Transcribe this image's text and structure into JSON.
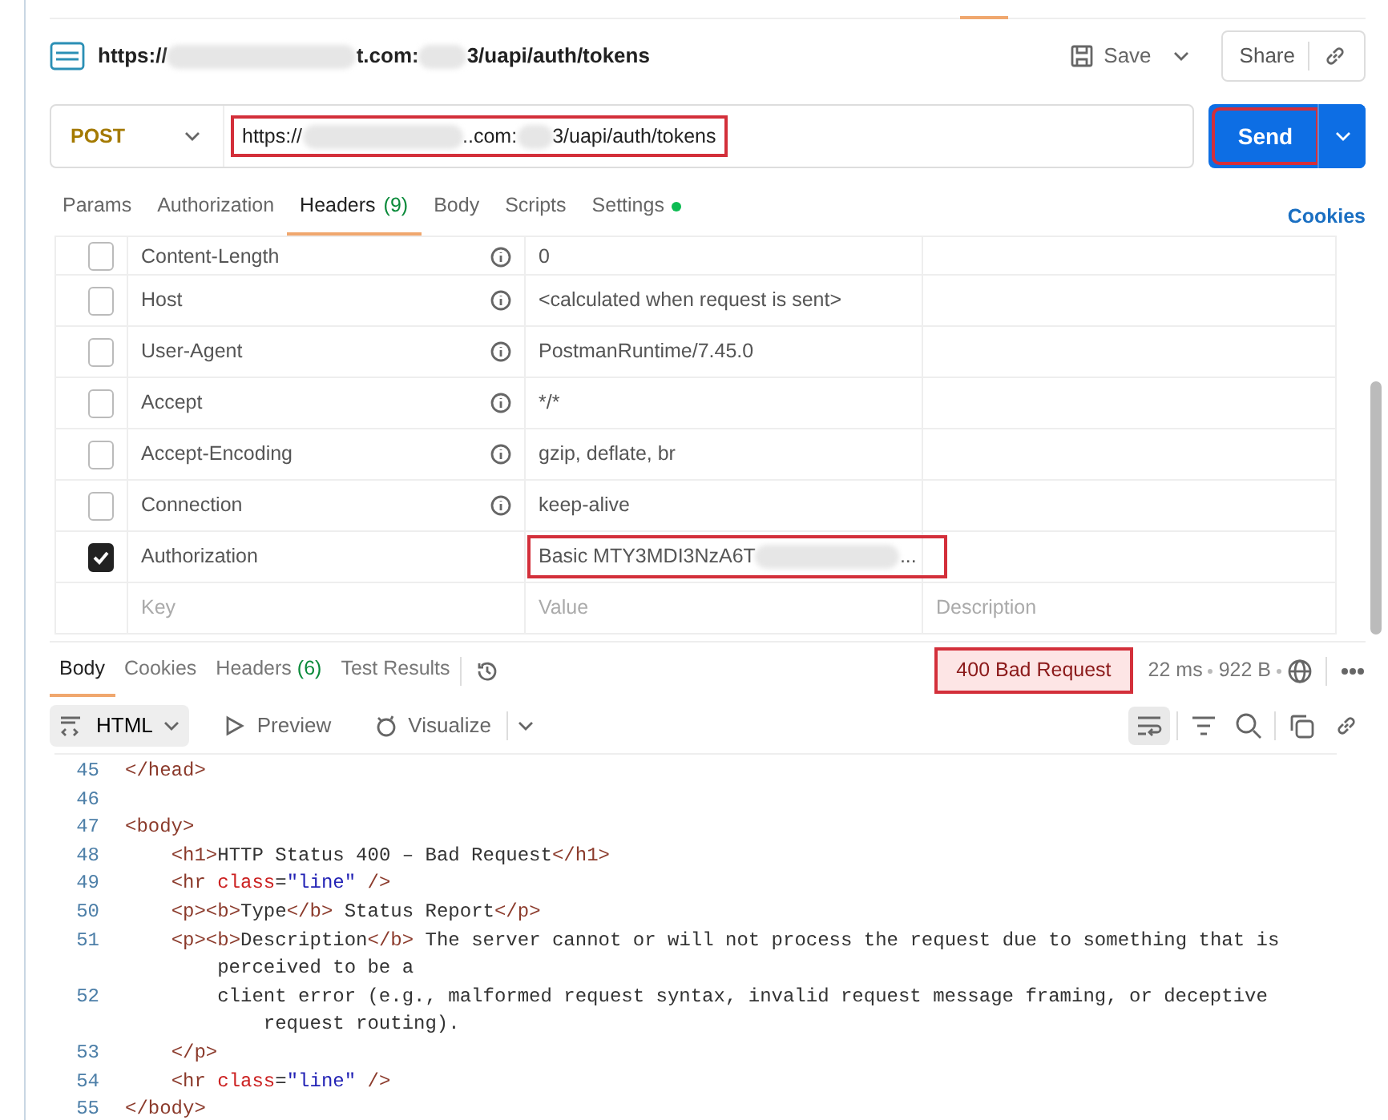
{
  "request_title": {
    "url_parts": [
      {
        "kind": "text",
        "text": "https://"
      },
      {
        "kind": "redacted"
      },
      {
        "kind": "text",
        "text": "t.com:"
      },
      {
        "kind": "redacted"
      },
      {
        "kind": "text",
        "text": "3/uapi/auth/tokens"
      }
    ]
  },
  "save_button": {
    "label": "Save"
  },
  "share_button": {
    "label": "Share"
  },
  "url_bar": {
    "method": "POST",
    "highlighted": true,
    "url_parts": [
      {
        "kind": "text",
        "text": "https://"
      },
      {
        "kind": "redacted"
      },
      {
        "kind": "text",
        "text": "..com:"
      },
      {
        "kind": "redacted"
      },
      {
        "kind": "text",
        "text": "3/uapi/auth/tokens"
      }
    ]
  },
  "send_button": {
    "label": "Send",
    "highlighted": true
  },
  "request_tabs": [
    {
      "label": "Params",
      "selected": false,
      "modified": false
    },
    {
      "label": "Authorization",
      "selected": false,
      "modified": false
    },
    {
      "label": "Headers",
      "count": "(9)",
      "selected": true,
      "modified": false
    },
    {
      "label": "Body",
      "selected": false,
      "modified": false
    },
    {
      "label": "Scripts",
      "selected": false,
      "modified": false
    },
    {
      "label": "Settings",
      "selected": false,
      "modified": true
    }
  ],
  "cookies_link": "Cookies",
  "headers": [
    {
      "key": "Content-Length",
      "checked": false,
      "info": true,
      "highlighted": false,
      "value_parts": [
        {
          "kind": "text",
          "text": "0"
        }
      ]
    },
    {
      "key": "Host",
      "checked": false,
      "info": true,
      "highlighted": false,
      "value_parts": [
        {
          "kind": "text",
          "text": "<calculated when request is sent>"
        }
      ]
    },
    {
      "key": "User-Agent",
      "checked": false,
      "info": true,
      "highlighted": false,
      "value_parts": [
        {
          "kind": "text",
          "text": "PostmanRuntime/7.45.0"
        }
      ]
    },
    {
      "key": "Accept",
      "checked": false,
      "info": true,
      "highlighted": false,
      "value_parts": [
        {
          "kind": "text",
          "text": "*/*"
        }
      ]
    },
    {
      "key": "Accept-Encoding",
      "checked": false,
      "info": true,
      "highlighted": false,
      "value_parts": [
        {
          "kind": "text",
          "text": "gzip, deflate, br"
        }
      ]
    },
    {
      "key": "Connection",
      "checked": false,
      "info": true,
      "highlighted": false,
      "value_parts": [
        {
          "kind": "text",
          "text": "keep-alive"
        }
      ]
    },
    {
      "key": "Authorization",
      "checked": true,
      "info": false,
      "highlighted": true,
      "value_parts": [
        {
          "kind": "text",
          "text": "Basic MTY3MDI3NzA6T"
        },
        {
          "kind": "redacted"
        },
        {
          "kind": "text",
          "text": "..."
        }
      ]
    }
  ],
  "new_header_row": {
    "key_placeholder": "Key",
    "value_placeholder": "Value",
    "description_placeholder": "Description"
  },
  "response_tabs": [
    {
      "label": "Body",
      "selected": true
    },
    {
      "label": "Cookies",
      "selected": false
    },
    {
      "label": "Headers",
      "count": "(6)",
      "selected": false
    },
    {
      "label": "Test Results",
      "selected": false
    }
  ],
  "response_status": {
    "text": "400 Bad Request",
    "highlighted": true
  },
  "response_time": "22 ms",
  "response_size": "922 B",
  "format_dropdown": "HTML",
  "view_modes": [
    "Preview",
    "Visualize"
  ],
  "wrap_lines": true,
  "code_lines": [
    {
      "number": "45",
      "rows": [
        [
          {
            "kind": "tag",
            "text": "</head>"
          }
        ]
      ]
    },
    {
      "number": "46",
      "rows": [
        []
      ]
    },
    {
      "number": "47",
      "rows": [
        [
          {
            "kind": "tag",
            "text": "<body>"
          }
        ]
      ]
    },
    {
      "number": "48",
      "rows": [
        [
          {
            "kind": "text",
            "text": "    "
          },
          {
            "kind": "tag",
            "text": "<h1>"
          },
          {
            "kind": "text",
            "text": "HTTP Status 400 – Bad Request"
          },
          {
            "kind": "tag",
            "text": "</h1>"
          }
        ]
      ]
    },
    {
      "number": "49",
      "rows": [
        [
          {
            "kind": "text",
            "text": "    "
          },
          {
            "kind": "tag",
            "text": "<hr "
          },
          {
            "kind": "attr",
            "text": "class"
          },
          {
            "kind": "text",
            "text": "="
          },
          {
            "kind": "string",
            "text": "\"line\""
          },
          {
            "kind": "tag",
            "text": " />"
          }
        ]
      ]
    },
    {
      "number": "50",
      "rows": [
        [
          {
            "kind": "text",
            "text": "    "
          },
          {
            "kind": "tag",
            "text": "<p><b>"
          },
          {
            "kind": "text",
            "text": "Type"
          },
          {
            "kind": "tag",
            "text": "</b>"
          },
          {
            "kind": "text",
            "text": " Status Report"
          },
          {
            "kind": "tag",
            "text": "</p>"
          }
        ]
      ]
    },
    {
      "number": "51",
      "rows": [
        [
          {
            "kind": "text",
            "text": "    "
          },
          {
            "kind": "tag",
            "text": "<p><b>"
          },
          {
            "kind": "text",
            "text": "Description"
          },
          {
            "kind": "tag",
            "text": "</b>"
          },
          {
            "kind": "text",
            "text": " The server cannot or will not process the request due to something that is"
          }
        ],
        [
          {
            "kind": "text",
            "text": "perceived to be a"
          }
        ]
      ]
    },
    {
      "number": "52",
      "rows": [
        [
          {
            "kind": "text",
            "text": "        client error (e.g., malformed request syntax, invalid request message framing, or deceptive"
          }
        ],
        [
          {
            "kind": "text",
            "text": "request routing)."
          }
        ]
      ]
    },
    {
      "number": "53",
      "rows": [
        [
          {
            "kind": "text",
            "text": "    "
          },
          {
            "kind": "tag",
            "text": "</p>"
          }
        ]
      ]
    },
    {
      "number": "54",
      "rows": [
        [
          {
            "kind": "text",
            "text": "    "
          },
          {
            "kind": "tag",
            "text": "<hr "
          },
          {
            "kind": "attr",
            "text": "class"
          },
          {
            "kind": "text",
            "text": "="
          },
          {
            "kind": "string",
            "text": "\"line\""
          },
          {
            "kind": "tag",
            "text": " />"
          }
        ]
      ]
    },
    {
      "number": "55",
      "rows": [
        [
          {
            "kind": "tag",
            "text": "</body>"
          }
        ]
      ]
    }
  ]
}
